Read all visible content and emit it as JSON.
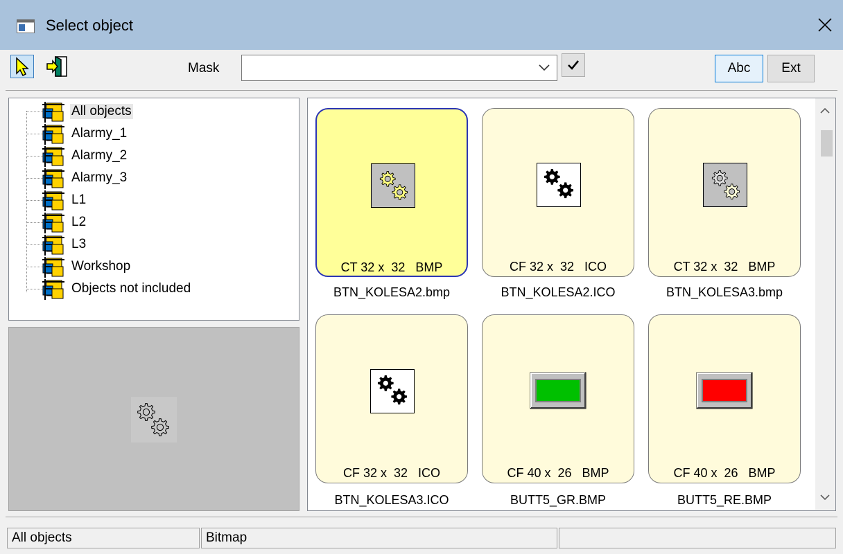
{
  "window": {
    "title": "Select object",
    "title_icon": "window-icon",
    "close_icon": "close-icon"
  },
  "toolbar": {
    "select_tool_icon": "arrow-pointer-icon",
    "enter_tool_icon": "enter-door-icon",
    "mask_label": "Mask",
    "mask_value": "",
    "abc_label": "Abc",
    "ext_label": "Ext"
  },
  "tree": {
    "items": [
      {
        "label": "All objects",
        "selected": true
      },
      {
        "label": "Alarmy_1"
      },
      {
        "label": "Alarmy_2"
      },
      {
        "label": "Alarmy_3"
      },
      {
        "label": "L1"
      },
      {
        "label": "L2"
      },
      {
        "label": "L3"
      },
      {
        "label": "Workshop"
      },
      {
        "label": "Objects not included"
      }
    ]
  },
  "preview": {
    "icon": "gears-icon"
  },
  "grid": {
    "tiles": [
      {
        "info": "CT 32 x  32   BMP",
        "name": "BTN_KOLESA2.bmp",
        "icon": "gears-yellow-icon",
        "selected": true
      },
      {
        "info": "CF 32 x  32   ICO",
        "name": "BTN_KOLESA2.ICO",
        "icon": "gears-black-icon"
      },
      {
        "info": "CT 32 x  32   BMP",
        "name": "BTN_KOLESA3.bmp",
        "icon": "gears-light-icon"
      },
      {
        "info": "CF 32 x  32   ICO",
        "name": "BTN_KOLESA3.ICO",
        "icon": "gears-black-icon"
      },
      {
        "info": "CF 40 x  26   BMP",
        "name": "BUTT5_GR.BMP",
        "icon": "green-button-icon"
      },
      {
        "info": "CF 40 x  26   BMP",
        "name": "BUTT5_RE.BMP",
        "icon": "red-button-icon"
      }
    ]
  },
  "colors": {
    "titlebar": "#a9c2dc",
    "tile_bg": "#fffbdb",
    "tile_selected_bg": "#ffff99",
    "tile_selected_border": "#2b35b5",
    "preview_bg": "#c0c0c0",
    "green": "#00c000",
    "red": "#ff0000"
  },
  "status": {
    "cell1": "All objects",
    "cell2": "Bitmap",
    "cell3": ""
  }
}
